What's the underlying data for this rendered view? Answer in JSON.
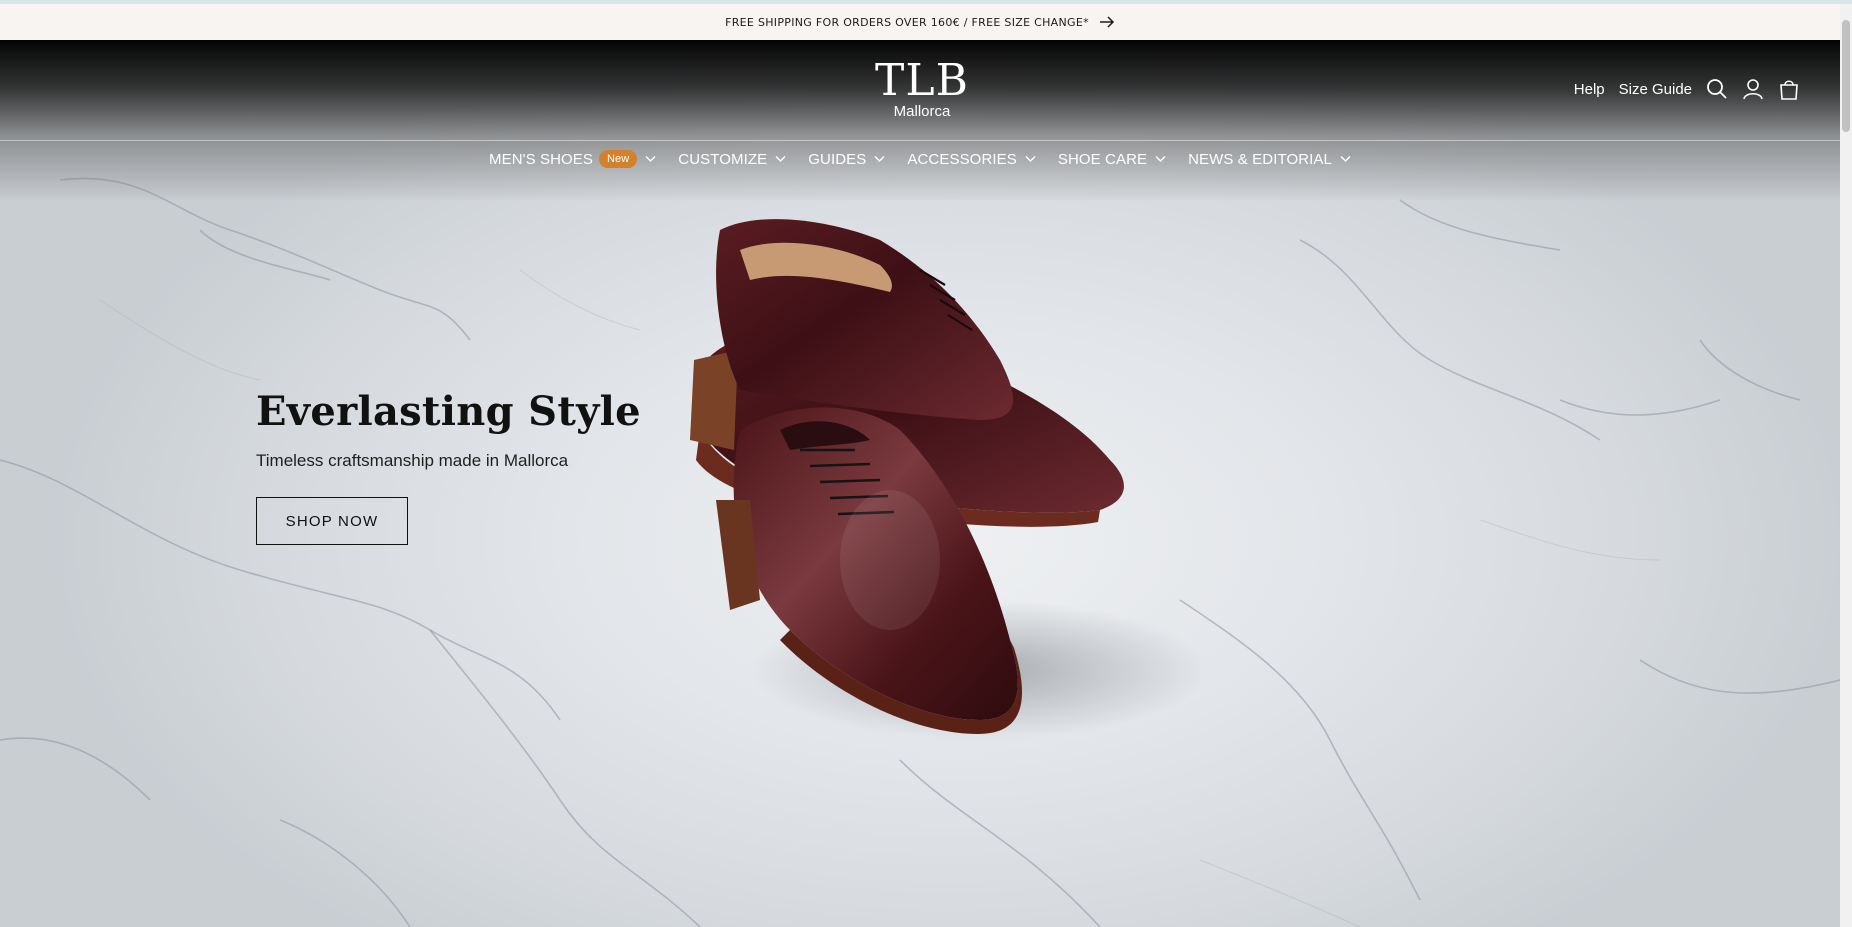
{
  "announcement": {
    "text": "FREE SHIPPING FOR ORDERS OVER 160€ / FREE SIZE CHANGE*",
    "icon": "arrow-right-icon"
  },
  "brand": {
    "mark": "TLB",
    "sub": "Mallorca"
  },
  "header": {
    "help_label": "Help",
    "size_guide_label": "Size Guide",
    "icons": [
      "search-icon",
      "account-icon",
      "cart-icon"
    ]
  },
  "nav": {
    "items": [
      {
        "label": "MEN'S SHOES",
        "badge": "New"
      },
      {
        "label": "CUSTOMIZE"
      },
      {
        "label": "GUIDES"
      },
      {
        "label": "ACCESSORIES"
      },
      {
        "label": "SHOE CARE"
      },
      {
        "label": "NEWS & EDITORIAL"
      }
    ]
  },
  "hero": {
    "title": "Everlasting Style",
    "subtitle": "Timeless craftsmanship made in Mallorca",
    "cta_label": "SHOP NOW",
    "image": "burgundy-oxford-shoes-on-marble"
  },
  "colors": {
    "badge": "#d3812a",
    "shoe_leather": "#4a1418",
    "announcement_bg": "#f7f4f1"
  }
}
